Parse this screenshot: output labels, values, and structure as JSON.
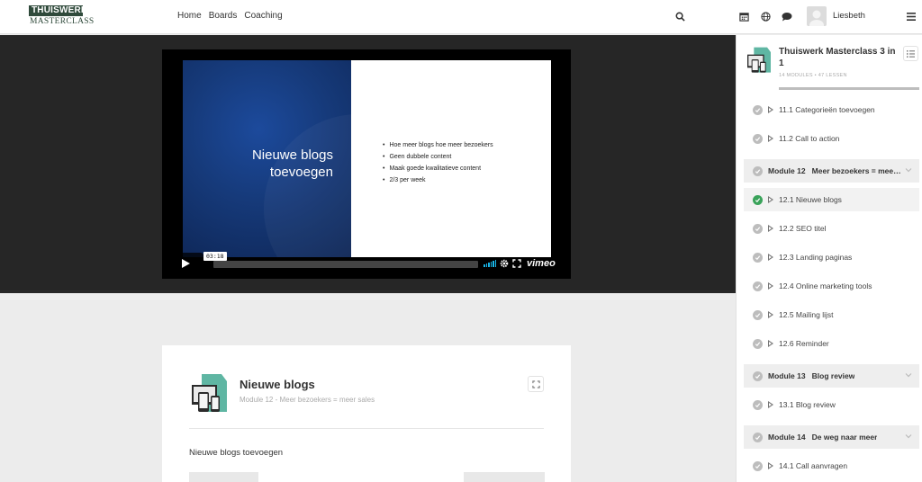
{
  "brand": {
    "logo_top": "THUISWERK",
    "logo_bottom": "MASTERCLASS",
    "color": "#2f4a3b"
  },
  "nav": {
    "home": "Home",
    "boards": "Boards",
    "coaching": "Coaching"
  },
  "header_icons": [
    "search-icon",
    "calendar-icon",
    "globe-icon",
    "chat-icon",
    "menu-icon"
  ],
  "user": {
    "name": "Liesbeth"
  },
  "video": {
    "slide_title_line1": "Nieuwe blogs",
    "slide_title_line2": "toevoegen",
    "bullets": [
      "Hoe meer blogs hoe meer bezoekers",
      "Geen dubbele content",
      "Maak goede kwalitatieve content",
      "2/3 per week"
    ],
    "time": "03:18",
    "provider": "vimeo"
  },
  "lesson": {
    "title": "Nieuwe blogs",
    "subtitle": "Module 12 - Meer bezoekers = meer sales",
    "body": "Nieuwe blogs toevoegen"
  },
  "course": {
    "title": "Thuiswerk Masterclass 3 in 1",
    "meta": "14 MODULES  •  47 LESSEN",
    "accent": "#3aa35a"
  },
  "sidebar_items": [
    {
      "type": "lesson",
      "label": "11.1 Categorieën toevoegen",
      "done": false
    },
    {
      "type": "lesson",
      "label": "11.2 Call to action",
      "done": false
    },
    {
      "type": "module",
      "label": "Module 12",
      "title": "Meer bezoekers = meer sales"
    },
    {
      "type": "lesson",
      "label": "12.1 Nieuwe blogs",
      "done": true,
      "active": true
    },
    {
      "type": "lesson",
      "label": "12.2 SEO titel",
      "done": false
    },
    {
      "type": "lesson",
      "label": "12.3 Landing paginas",
      "done": false
    },
    {
      "type": "lesson",
      "label": "12.4 Online marketing tools",
      "done": false
    },
    {
      "type": "lesson",
      "label": "12.5 Mailing lijst",
      "done": false
    },
    {
      "type": "lesson",
      "label": "12.6 Reminder",
      "done": false
    },
    {
      "type": "module",
      "label": "Module 13",
      "title": "Blog review"
    },
    {
      "type": "lesson",
      "label": "13.1 Blog review",
      "done": false
    },
    {
      "type": "module",
      "label": "Module 14",
      "title": "De weg naar meer"
    },
    {
      "type": "lesson",
      "label": "14.1 Call aanvragen",
      "done": false
    }
  ]
}
